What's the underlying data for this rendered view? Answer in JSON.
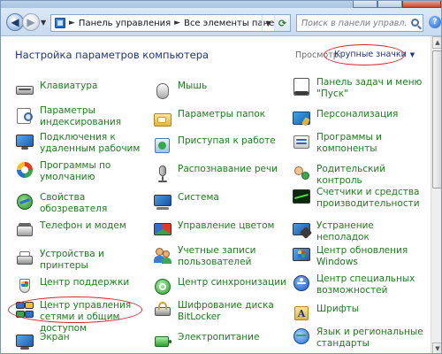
{
  "window": {
    "breadcrumbs": [
      "Панель управления",
      "Все элементы панели управления"
    ],
    "search_placeholder": "Поиск в панели управл...",
    "help_label": "?"
  },
  "header": {
    "title": "Настройка параметров компьютера",
    "view_label": "Просмотр:",
    "view_value": "Крупные значки"
  },
  "items": [
    {
      "label": "Клавиатура",
      "icon": "keyboard-icon"
    },
    {
      "label": "Мышь",
      "icon": "mouse-icon"
    },
    {
      "label": "Панель задач и меню \"Пуск\"",
      "icon": "taskbar-icon"
    },
    {
      "label": "Параметры индексирования",
      "icon": "indexing-icon"
    },
    {
      "label": "Параметры папок",
      "icon": "folder-options-icon"
    },
    {
      "label": "Персонализация",
      "icon": "personalization-icon"
    },
    {
      "label": "Подключения к удаленным рабочим",
      "icon": "remote-desktop-icon"
    },
    {
      "label": "Приступая к работе",
      "icon": "getting-started-icon"
    },
    {
      "label": "Программы и компоненты",
      "icon": "programs-icon"
    },
    {
      "label": "Программы по умолчанию",
      "icon": "default-programs-icon"
    },
    {
      "label": "Распознавание речи",
      "icon": "microphone-icon"
    },
    {
      "label": "Родительский контроль",
      "icon": "parental-control-icon"
    },
    {
      "label": "Свойства обозревателя",
      "icon": "internet-options-icon"
    },
    {
      "label": "Система",
      "icon": "system-icon"
    },
    {
      "label": "Счетчики и средства производительности",
      "icon": "performance-icon"
    },
    {
      "label": "Телефон и модем",
      "icon": "phone-modem-icon"
    },
    {
      "label": "Управление цветом",
      "icon": "color-management-icon"
    },
    {
      "label": "Устранение неполадок",
      "icon": "troubleshooting-icon"
    },
    {
      "label": "Устройства и принтеры",
      "icon": "printer-icon"
    },
    {
      "label": "Учетные записи пользователей",
      "icon": "user-accounts-icon"
    },
    {
      "label": "Центр обновления Windows",
      "icon": "windows-update-icon"
    },
    {
      "label": "Центр поддержки",
      "icon": "action-center-icon"
    },
    {
      "label": "Центр синхронизации",
      "icon": "sync-center-icon"
    },
    {
      "label": "Центр специальных возможностей",
      "icon": "accessibility-icon"
    },
    {
      "label": "Центр управления сетями и общим доступом",
      "icon": "network-center-icon"
    },
    {
      "label": "Шифрование диска BitLocker",
      "icon": "bitlocker-icon"
    },
    {
      "label": "Шрифты",
      "icon": "fonts-icon"
    },
    {
      "label": "Экран",
      "icon": "display-icon"
    },
    {
      "label": "Электропитание",
      "icon": "power-icon"
    },
    {
      "label": "Язык и региональные стандарты",
      "icon": "region-language-icon"
    }
  ],
  "colors": {
    "link_green": "#1e7b1e",
    "title_blue": "#1e3287",
    "annotation_red": "#d7262e"
  }
}
